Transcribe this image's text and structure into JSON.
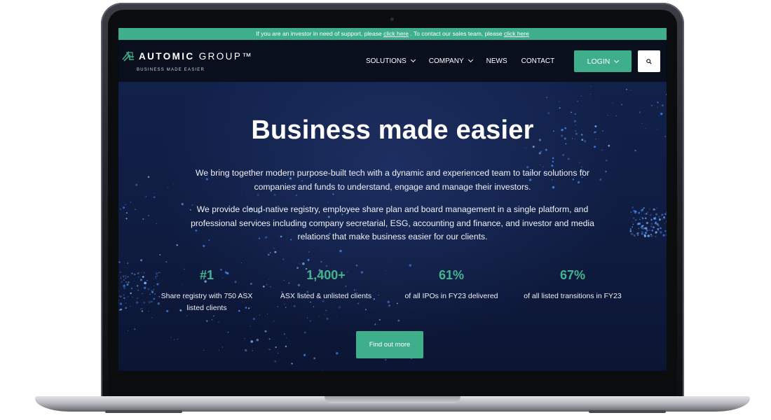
{
  "announcement": {
    "text_before": "If you are an investor in need of support, please",
    "link1": "click here",
    "text_middle": ". To contact our sales team, please",
    "link2": "click here"
  },
  "brand": {
    "name_bold": "AUTOMIC",
    "name_light": "GROUP™",
    "tagline": "BUSINESS MADE EASIER"
  },
  "nav": {
    "items": [
      {
        "label": "SOLUTIONS",
        "dropdown": true
      },
      {
        "label": "COMPANY",
        "dropdown": true
      },
      {
        "label": "NEWS",
        "dropdown": false
      },
      {
        "label": "CONTACT",
        "dropdown": false
      }
    ],
    "login_label": "LOGIN",
    "search_icon": "search-icon"
  },
  "hero": {
    "title": "Business made easier",
    "paragraph1": "We bring together modern purpose-built tech with a dynamic and experienced team to tailor solutions for companies and funds to understand, engage and manage their investors.",
    "paragraph2": "We provide cloud-native registry, employee share plan and board management in a single platform, and professional services including company secretarial, ESG, accounting and finance, and investor and media relations that make business easier for our clients.",
    "stats": [
      {
        "value": "#1",
        "label_line1": "Share registry with 750 ASX",
        "label_line2": "listed clients"
      },
      {
        "value": "1,400+",
        "label_line1": "ASX listed & unlisted clients",
        "label_line2": ""
      },
      {
        "value": "61%",
        "label_line1": "of all IPOs in FY23 delivered",
        "label_line2": ""
      },
      {
        "value": "67%",
        "label_line1": "of all listed transitions in FY23",
        "label_line2": ""
      }
    ],
    "cta_label": "Find out more"
  },
  "colors": {
    "accent": "#3fae8a",
    "nav_bg": "#0a0f1e",
    "hero_bg": "#0f1c40"
  }
}
